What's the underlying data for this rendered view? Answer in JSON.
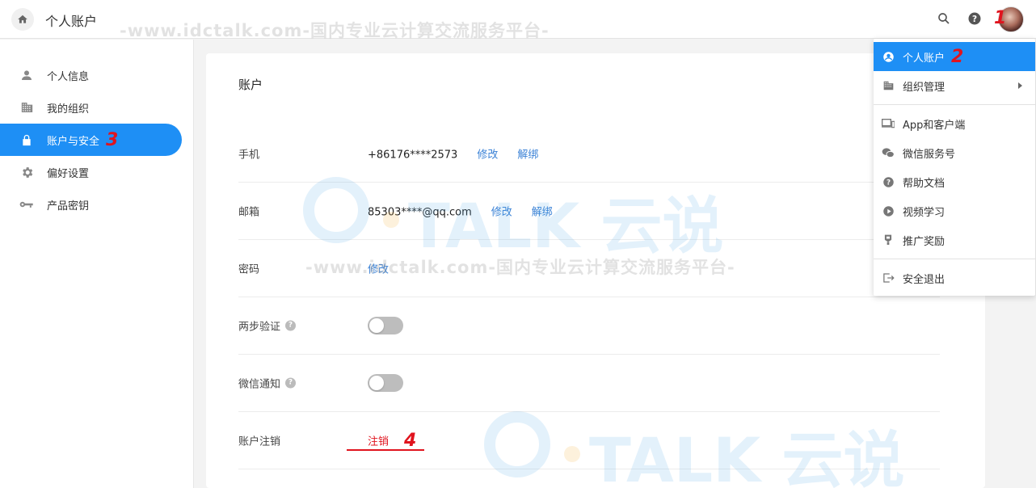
{
  "header": {
    "title": "个人账户"
  },
  "annotations": {
    "a1": "1",
    "a2": "2",
    "a3": "3",
    "a4": "4"
  },
  "sidebar": {
    "items": [
      {
        "label": "个人信息",
        "icon": "person-icon"
      },
      {
        "label": "我的组织",
        "icon": "building-icon"
      },
      {
        "label": "账户与安全",
        "icon": "lock-icon",
        "active": true
      },
      {
        "label": "偏好设置",
        "icon": "gear-icon"
      },
      {
        "label": "产品密钥",
        "icon": "key-icon"
      }
    ]
  },
  "main": {
    "title": "账户",
    "rows": {
      "phone": {
        "label": "手机",
        "value": "+86176****2573",
        "edit": "修改",
        "unbind": "解绑"
      },
      "email": {
        "label": "邮箱",
        "value": "85303****@qq.com",
        "edit": "修改",
        "unbind": "解绑"
      },
      "password": {
        "label": "密码",
        "edit": "修改"
      },
      "two_step": {
        "label": "两步验证",
        "enabled": false
      },
      "wechat_notify": {
        "label": "微信通知",
        "enabled": false
      },
      "deactivate": {
        "label": "账户注销",
        "action": "注销"
      }
    }
  },
  "menu": {
    "items": [
      {
        "label": "个人账户",
        "icon": "user-circle-icon",
        "active": true
      },
      {
        "label": "组织管理",
        "icon": "building-icon",
        "submenu": true
      },
      {
        "label": "App和客户端",
        "icon": "devices-icon"
      },
      {
        "label": "微信服务号",
        "icon": "wechat-icon"
      },
      {
        "label": "帮助文档",
        "icon": "help-icon"
      },
      {
        "label": "视频学习",
        "icon": "play-icon"
      },
      {
        "label": "推广奖励",
        "icon": "trophy-icon"
      },
      {
        "label": "安全退出",
        "icon": "logout-icon"
      }
    ]
  },
  "watermark": {
    "url_text": "-www.idctalk.com-国内专业云计算交流服务平台-",
    "logo_text": "TALK 云说"
  },
  "colors": {
    "accent": "#1e8ff5",
    "link": "#3b82d6",
    "danger": "#e0141e"
  }
}
